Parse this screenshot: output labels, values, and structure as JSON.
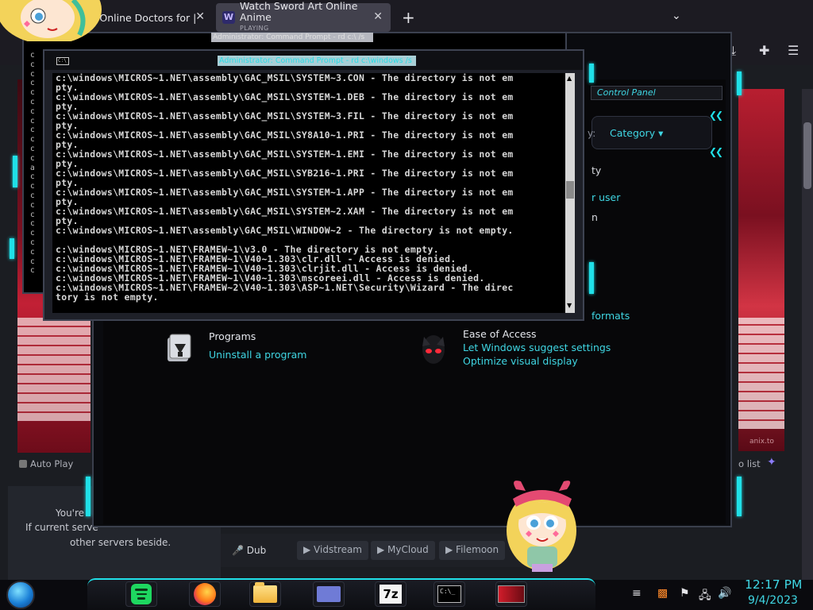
{
  "browser": {
    "tabs": [
      {
        "label": "st Online Doctors for |"
      },
      {
        "label": "Watch Sword Art Online Anime",
        "sub": "PLAYING"
      }
    ],
    "new_tab": "+",
    "tab_close": "✕",
    "list_tabs": "⌄"
  },
  "page": {
    "autoplay": "Auto Play",
    "to_list": "o list",
    "notice_lines": [
      "You're",
      "If current serve",
      "other servers beside."
    ],
    "servers": {
      "dub": "Dub",
      "options": [
        "Vidstream",
        "MyCloud",
        "Filemoon"
      ]
    },
    "watermark": "anix.to"
  },
  "control_panel": {
    "address": "Control Panel",
    "view_by": {
      "label": "y:",
      "value": "Category"
    },
    "right_fragments": [
      {
        "text": "ty",
        "type": "text"
      },
      {
        "text": "r user",
        "type": "link"
      },
      {
        "text": "n",
        "type": "text"
      },
      {
        "text": "formats",
        "type": "link"
      }
    ],
    "programs": {
      "title": "Programs",
      "link": "Uninstall a program"
    },
    "ease": {
      "title": "Ease of Access",
      "links": [
        "Let Windows suggest settings",
        "Optimize visual display"
      ]
    }
  },
  "cmd_back": {
    "title": "Administrator: Command Prompt - rd c:\\ /s",
    "col_chars": [
      "c",
      "c",
      "c",
      "c",
      "c",
      "c",
      "c",
      "c",
      "c",
      "c",
      "c",
      "c",
      "a",
      "c",
      "c",
      "c",
      "c",
      "c",
      "c",
      "c",
      "c",
      "c",
      "c",
      "c"
    ]
  },
  "cmd_front": {
    "title": "Administrator: Command Prompt - rd c:\\windows /s",
    "icon": "C:\\",
    "lines": [
      "c:\\windows\\MICROS~1.NET\\assembly\\GAC_MSIL\\SYSTEM~3.CON - The directory is not em",
      "pty.",
      "c:\\windows\\MICROS~1.NET\\assembly\\GAC_MSIL\\SYSTEM~1.DEB - The directory is not em",
      "pty.",
      "c:\\windows\\MICROS~1.NET\\assembly\\GAC_MSIL\\SYSTEM~3.FIL - The directory is not em",
      "pty.",
      "c:\\windows\\MICROS~1.NET\\assembly\\GAC_MSIL\\SY8A10~1.PRI - The directory is not em",
      "pty.",
      "c:\\windows\\MICROS~1.NET\\assembly\\GAC_MSIL\\SYSTEM~1.EMI - The directory is not em",
      "pty.",
      "c:\\windows\\MICROS~1.NET\\assembly\\GAC_MSIL\\SYB216~1.PRI - The directory is not em",
      "pty.",
      "c:\\windows\\MICROS~1.NET\\assembly\\GAC_MSIL\\SYSTEM~1.APP - The directory is not em",
      "pty.",
      "c:\\windows\\MICROS~1.NET\\assembly\\GAC_MSIL\\SYSTEM~2.XAM - The directory is not em",
      "pty.",
      "c:\\windows\\MICROS~1.NET\\assembly\\GAC_MSIL\\WINDOW~2 - The directory is not empty.",
      "",
      "c:\\windows\\MICROS~1.NET\\FRAMEW~1\\v3.0 - The directory is not empty.",
      "c:\\windows\\MICROS~1.NET\\FRAMEW~1\\V40~1.303\\clr.dll - Access is denied.",
      "c:\\windows\\MICROS~1.NET\\FRAMEW~1\\V40~1.303\\clrjit.dll - Access is denied.",
      "c:\\windows\\MICROS~1.NET\\FRAMEW~1\\V40~1.303\\mscoreei.dll - Access is denied.",
      "c:\\windows\\MICROS~1.NET\\FRAMEW~2\\V40~1.303\\ASP~1.NET\\Security\\Wizard - The direc",
      "tory is not empty."
    ],
    "scroll_up": "▲",
    "scroll_down": "▼"
  },
  "taskbar": {
    "sevenzip_label": "7z",
    "cmd_label": "C:\\_",
    "clock_time": "12:17 PM",
    "clock_date": "9/4/2023"
  },
  "colors": {
    "accent": "#20e0e8",
    "link": "#3fd6e3",
    "console_text": "#d8d8d8"
  }
}
